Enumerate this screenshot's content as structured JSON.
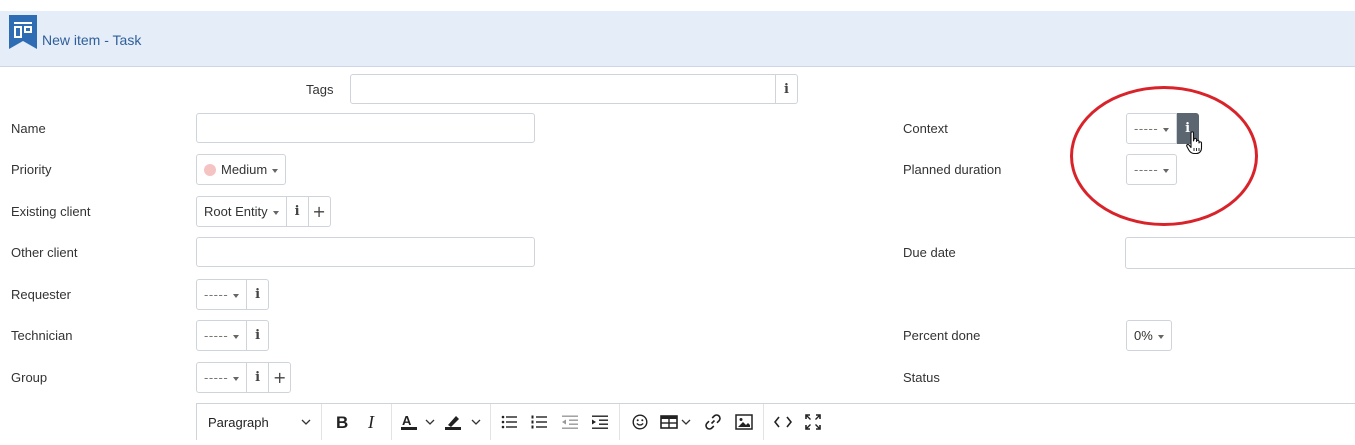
{
  "header": {
    "title": "New item - Task",
    "logo_icon": "task-board-icon"
  },
  "form": {
    "tags_label": "Tags",
    "name_label": "Name",
    "priority_label": "Priority",
    "priority_value": "Medium",
    "existing_client_label": "Existing client",
    "existing_client_value": "Root Entity",
    "other_client_label": "Other client",
    "requester_label": "Requester",
    "requester_value": "-----",
    "technician_label": "Technician",
    "technician_value": "-----",
    "group_label": "Group",
    "group_value": "-----",
    "context_label": "Context",
    "context_value": "-----",
    "planned_duration_label": "Planned duration",
    "planned_duration_value": "-----",
    "due_date_label": "Due date",
    "percent_done_label": "Percent done",
    "percent_done_value": "0%",
    "status_label": "Status"
  },
  "editor": {
    "block_format": "Paragraph"
  },
  "icons": {
    "info": "i",
    "plus": "+"
  },
  "colors": {
    "header_bg": "#e5edf8",
    "title": "#2f5f9a",
    "highlight_circle": "#d9232a",
    "priority_medium": "#f6c3c3"
  }
}
